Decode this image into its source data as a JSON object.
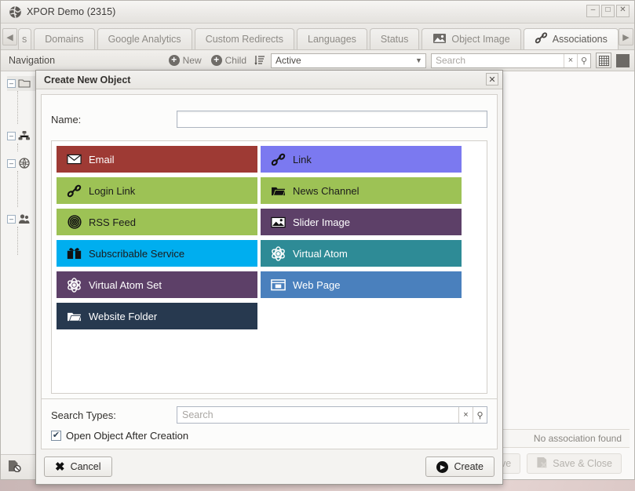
{
  "window": {
    "title": "XPOR Demo (2315)",
    "icon": "globe-icon",
    "minimize": "–",
    "maximize": "□",
    "close": "✕"
  },
  "tabs": {
    "scroll_left": "◀",
    "scroll_right": "▶",
    "items": [
      {
        "label": "s",
        "icon": "",
        "active": false,
        "clipped": true
      },
      {
        "label": "Domains",
        "icon": "",
        "active": false
      },
      {
        "label": "Google Analytics",
        "icon": "",
        "active": false
      },
      {
        "label": "Custom Redirects",
        "icon": "",
        "active": false
      },
      {
        "label": "Languages",
        "icon": "",
        "active": false
      },
      {
        "label": "Status",
        "icon": "",
        "active": false
      },
      {
        "label": "Object Image",
        "icon": "image-icon",
        "active": false
      },
      {
        "label": "Associations",
        "icon": "link-icon",
        "active": true
      }
    ]
  },
  "toolbar": {
    "navigation_label": "Navigation",
    "new_label": "New",
    "child_label": "Child",
    "sort_icon": "sort-icon",
    "filter_value": "Active",
    "search_placeholder": "Search",
    "clear_icon": "×",
    "search_icon": "⚲",
    "grid_icon": "grid-icon",
    "square_icon": "square-icon"
  },
  "tree": {
    "nodes": [
      {
        "expander": "–",
        "icon": "folder-icon"
      },
      {
        "expander": "–",
        "icon": "sitemap-icon"
      },
      {
        "expander": "–",
        "icon": "globe-icon"
      },
      {
        "expander": "–",
        "icon": "users-icon"
      }
    ],
    "footer_icon": "no-object-icon"
  },
  "panel": {
    "status_text": "No association found",
    "save_label": "Save",
    "save_close_label": "Save & Close",
    "save_icon": "save-icon",
    "save_close_icon": "save-close-icon"
  },
  "dialog": {
    "title": "Create New Object",
    "close_icon": "✕",
    "name_label": "Name:",
    "name_value": "",
    "search_types_label": "Search Types:",
    "search_placeholder": "Search",
    "search_value": "",
    "search_clear_icon": "×",
    "search_icon": "⚲",
    "checkbox_label": "Open Object After Creation",
    "checkbox_checked": true,
    "checkbox_glyph": "✔",
    "cancel_label": "Cancel",
    "cancel_icon": "cancel-x-icon",
    "create_label": "Create",
    "create_icon": "play-circle-icon",
    "tiles": [
      {
        "label": "Email",
        "icon": "envelope-icon",
        "color": "#9e3a34",
        "text": "light"
      },
      {
        "label": "Link",
        "icon": "chain-icon",
        "color": "#7b79f0",
        "text": "dark"
      },
      {
        "label": "Login Link",
        "icon": "chain-icon",
        "color": "#9dc255",
        "text": "dark"
      },
      {
        "label": "News Channel",
        "icon": "folder-open-icon",
        "color": "#9dc255",
        "text": "dark"
      },
      {
        "label": "RSS Feed",
        "icon": "rss-icon",
        "color": "#9dc255",
        "text": "dark"
      },
      {
        "label": "Slider Image",
        "icon": "image-icon",
        "color": "#5d4068",
        "text": "light"
      },
      {
        "label": "Subscribable Service",
        "icon": "subscribe-icon",
        "color": "#00aeef",
        "text": "dark"
      },
      {
        "label": "Virtual Atom",
        "icon": "atom-icon",
        "color": "#2e8b96",
        "text": "light"
      },
      {
        "label": "Virtual Atom Set",
        "icon": "atom-icon",
        "color": "#5d4068",
        "text": "light"
      },
      {
        "label": "Web Page",
        "icon": "browser-icon",
        "color": "#4a80bd",
        "text": "light"
      },
      {
        "label": "Website Folder",
        "icon": "folder-open-icon",
        "color": "#27394f",
        "text": "light"
      }
    ]
  }
}
